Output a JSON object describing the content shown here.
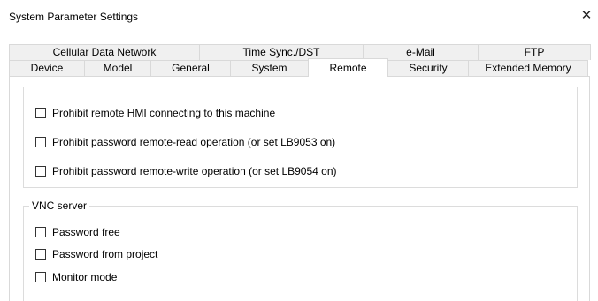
{
  "dialog": {
    "title": "System Parameter Settings",
    "close_glyph": "✕"
  },
  "tabs": {
    "back_row": [
      "Cellular Data Network",
      "Time Sync./DST",
      "e-Mail",
      "FTP"
    ],
    "front_row": [
      "Device",
      "Model",
      "General",
      "System",
      "Remote",
      "Security",
      "Extended Memory"
    ],
    "active": "Remote"
  },
  "remote": {
    "options": [
      {
        "label": "Prohibit remote HMI connecting to this machine",
        "checked": false
      },
      {
        "label": "Prohibit password remote-read operation (or set LB9053 on)",
        "checked": false
      },
      {
        "label": "Prohibit password remote-write operation (or set LB9054 on)",
        "checked": false
      }
    ]
  },
  "vnc": {
    "legend": "VNC server",
    "options": [
      {
        "label": "Password free",
        "checked": false
      },
      {
        "label": "Password from project",
        "checked": false
      },
      {
        "label": "Monitor mode",
        "checked": false
      }
    ]
  },
  "icons": {
    "close": "close-icon"
  }
}
